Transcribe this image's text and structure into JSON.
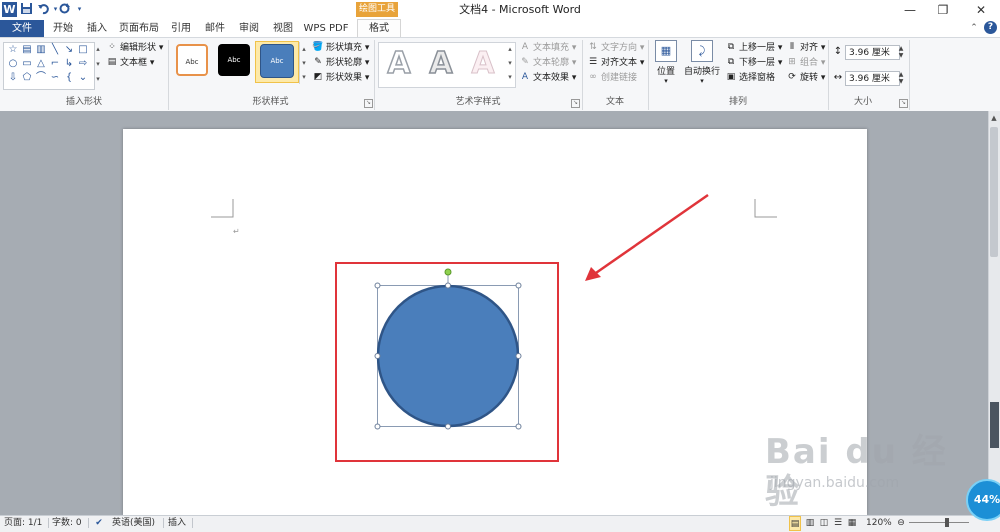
{
  "window": {
    "title": "文档4 - Microsoft Word",
    "context_tab_header": "绘图工具",
    "min_label": "—",
    "restore_label": "❐",
    "close_label": "✕"
  },
  "quick_access": {
    "word_icon": "W",
    "save_icon": "save-icon",
    "undo_icon": "undo-icon",
    "redo_icon": "redo-icon"
  },
  "tabs": [
    "文件",
    "开始",
    "插入",
    "页面布局",
    "引用",
    "邮件",
    "审阅",
    "视图",
    "WPS PDF",
    "格式"
  ],
  "ribbon": {
    "insert_shapes": {
      "label": "插入形状",
      "edit_shape": "编辑形状",
      "text_box": "文本框"
    },
    "shape_styles": {
      "label": "形状样式",
      "styles": [
        "Abc",
        "Abc",
        "Abc"
      ],
      "fill": "形状填充",
      "outline": "形状轮廓",
      "effects": "形状效果"
    },
    "wordart": {
      "label": "艺术字样式",
      "glyph": "A",
      "text_fill": "文本填充",
      "text_outline": "文本轮廓",
      "text_effects": "文本效果"
    },
    "text": {
      "label": "文本",
      "direction": "文字方向",
      "align": "对齐文本",
      "link": "创建链接"
    },
    "arrange": {
      "label": "排列",
      "position": "位置",
      "wrap": "自动换行",
      "bring_forward": "上移一层",
      "send_backward": "下移一层",
      "selection_pane": "选择窗格",
      "align": "对齐",
      "group": "组合",
      "rotate": "旋转"
    },
    "size": {
      "label": "大小",
      "height": "3.96 厘米",
      "width": "3.96 厘米"
    }
  },
  "colors": {
    "shape_fill": "#4a7ebb",
    "shape_stroke": "#2f5587",
    "annotation": "#e0343a",
    "accent": "#2b579a"
  },
  "statusbar": {
    "page": "页面: 1/1",
    "words": "字数: 0",
    "language": "英语(美国)",
    "mode": "插入",
    "zoom": "120%"
  },
  "watermark": {
    "logo": "Bai du 经验",
    "url": "jingyan.baidu.com"
  },
  "badge": "44%"
}
